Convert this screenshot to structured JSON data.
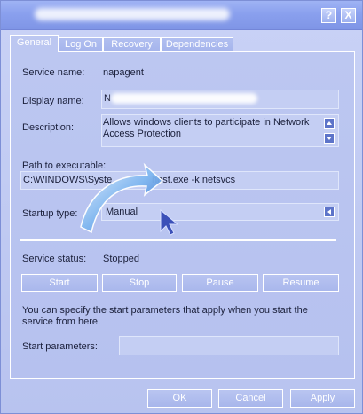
{
  "window": {
    "help_button": "?",
    "close_button": "X"
  },
  "tabs": [
    {
      "label": "General"
    },
    {
      "label": "Log On"
    },
    {
      "label": "Recovery"
    },
    {
      "label": "Dependencies"
    }
  ],
  "general": {
    "service_name_label": "Service name:",
    "service_name_value": "napagent",
    "display_name_label": "Display name:",
    "display_name_value": "N",
    "description_label": "Description:",
    "description_value": "Allows windows clients to participate in Network Access Protection",
    "path_label": "Path to executable:",
    "path_value_part1": "C:\\WINDOWS\\Syste",
    "path_value_part2": "host.exe -k netsvcs",
    "startup_type_label": "Startup type:",
    "startup_type_value": "Manual",
    "service_status_label": "Service status:",
    "service_status_value": "Stopped",
    "buttons": {
      "start": "Start",
      "stop": "Stop",
      "pause": "Pause",
      "resume": "Resume"
    },
    "note": "You can specify the start parameters that apply when you start the service from here.",
    "start_parameters_label": "Start parameters:",
    "start_parameters_value": ""
  },
  "footer": {
    "ok": "OK",
    "cancel": "Cancel",
    "apply": "Apply"
  },
  "colors": {
    "titlebar": "#8aa0ee",
    "panel": "#bcc7f1",
    "accent": "#5d74c9"
  },
  "icons": {
    "overlay": "curved-arrow-icon",
    "cursor": "mouse-cursor-icon"
  }
}
